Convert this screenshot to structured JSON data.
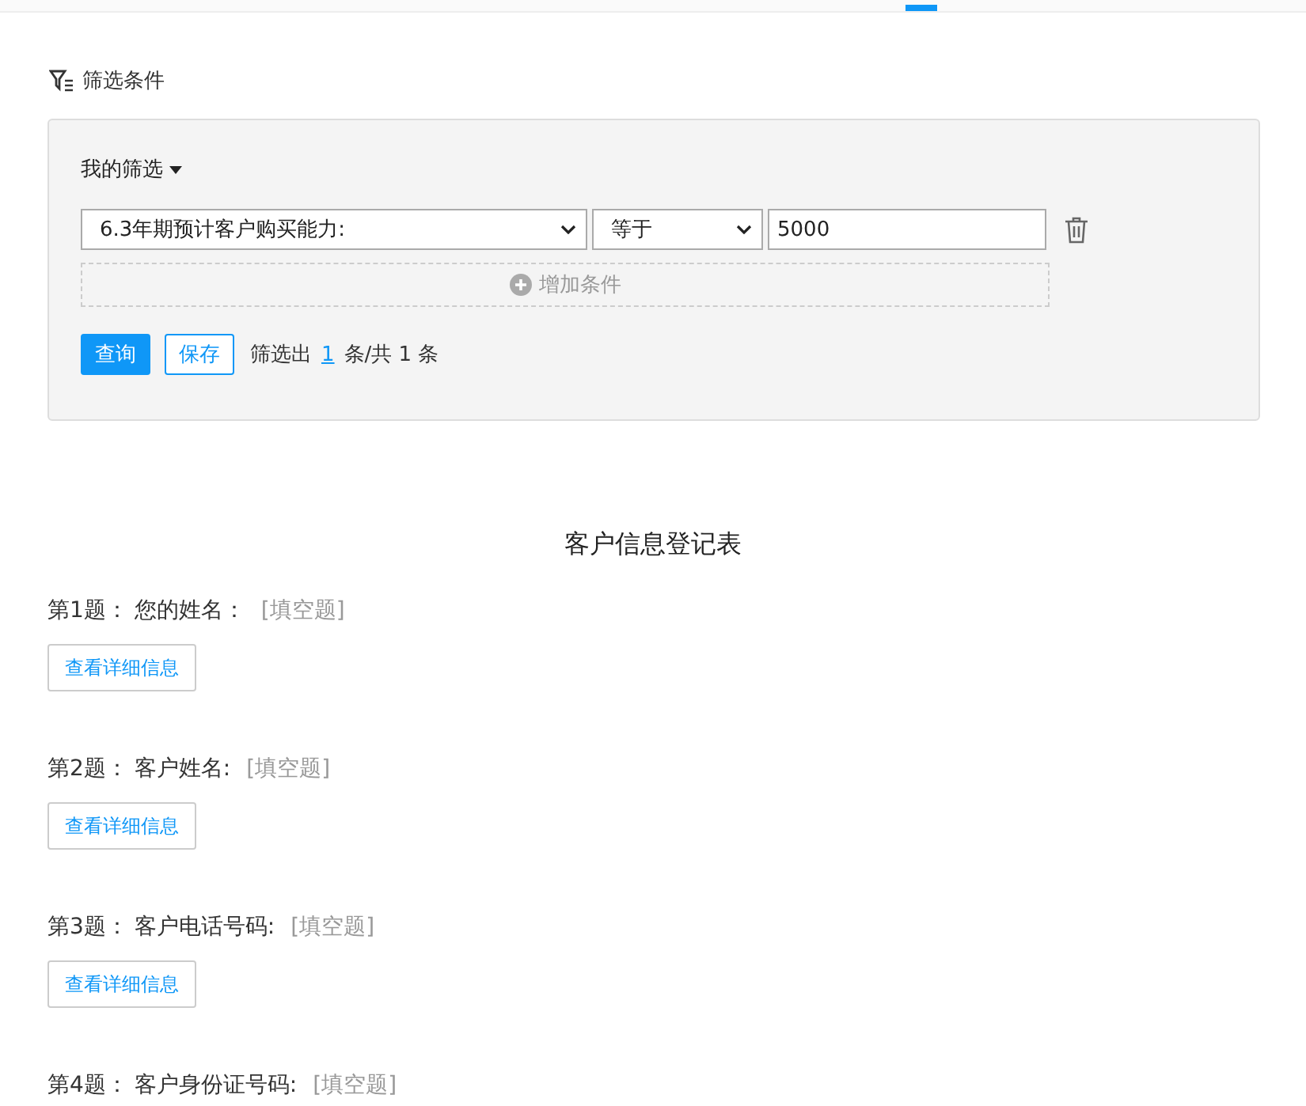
{
  "filter": {
    "title": "筛选条件",
    "my_filter": "我的筛选",
    "conditions": [
      {
        "field": "6.3年期预计客户购买能力:",
        "operator": "等于",
        "value": "5000"
      }
    ],
    "add_condition": "增加条件",
    "query_button": "查询",
    "save_button": "保存",
    "result_prefix": "筛选出",
    "result_link": "1",
    "result_suffix": "条/共 1 条"
  },
  "form_title": "客户信息登记表",
  "questions": [
    {
      "number": "第1题：",
      "title": "您的姓名：",
      "type": "[填空题]",
      "button": "查看详细信息"
    },
    {
      "number": "第2题：",
      "title": "客户姓名:",
      "type": "[填空题]",
      "button": "查看详细信息"
    },
    {
      "number": "第3题：",
      "title": "客户电话号码:",
      "type": "[填空题]",
      "button": "查看详细信息"
    },
    {
      "number": "第4题：",
      "title": "客户身份证号码:",
      "type": "[填空题]"
    }
  ]
}
